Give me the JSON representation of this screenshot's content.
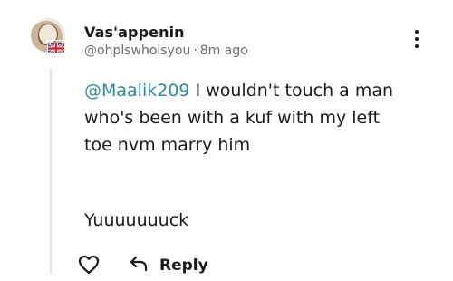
{
  "comment": {
    "author": {
      "username": "Vas'appenin",
      "handle": "@ohplswhoisyou",
      "flag_icon": "uk-flag-icon",
      "avatar_icon": "profile-avatar"
    },
    "separator": "·",
    "timestamp": "8m ago",
    "mention": "@Maalik209",
    "text": "I wouldn't touch a man who's been with a kuf with my left toe nvm marry him",
    "extra_line": "Yuuuuuuuck",
    "accent_color": "#2a8c94"
  },
  "actions": {
    "like_icon": "heart-icon",
    "reply_icon": "reply-arrow-icon",
    "reply_label": "Reply",
    "more_icon": "more-options-icon"
  }
}
